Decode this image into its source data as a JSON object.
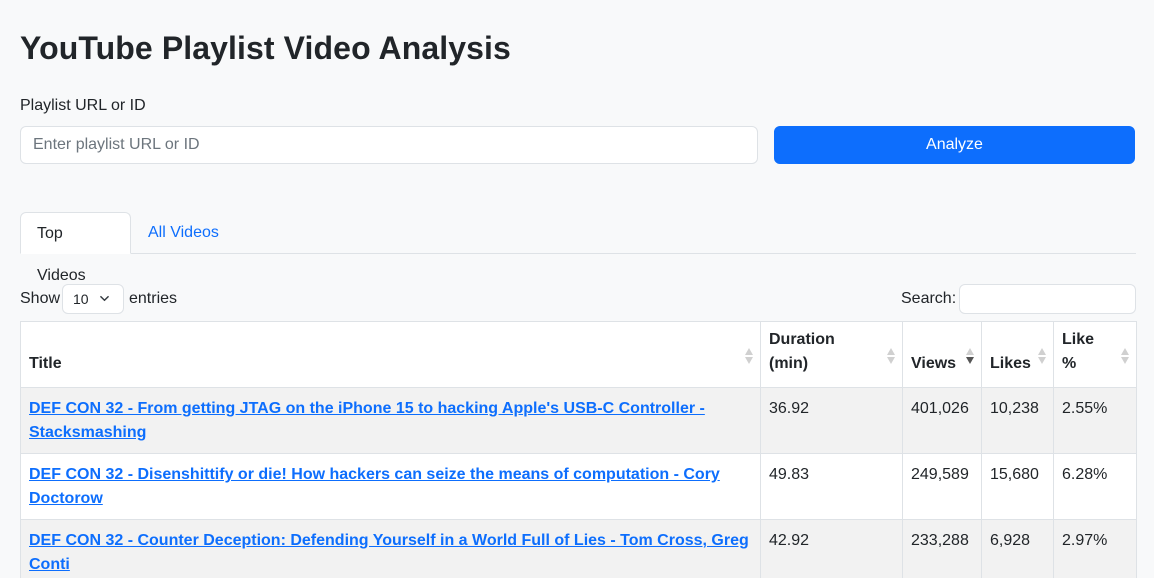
{
  "page": {
    "title": "YouTube Playlist Video Analysis"
  },
  "form": {
    "label": "Playlist URL or ID",
    "input_value": "",
    "placeholder": "Enter playlist URL or ID",
    "analyze_label": "Analyze"
  },
  "tabs": [
    {
      "label": "Top Videos",
      "active": true
    },
    {
      "label": "All Videos",
      "active": false
    }
  ],
  "table_controls": {
    "show_label": "Show",
    "entries_label": "entries",
    "page_length": "10",
    "search_label": "Search:",
    "search_value": ""
  },
  "table": {
    "columns": [
      {
        "label": "Title",
        "sort": "none"
      },
      {
        "label": "Duration (min)",
        "sort": "none"
      },
      {
        "label": "Views",
        "sort": "desc"
      },
      {
        "label": "Likes",
        "sort": "none"
      },
      {
        "label": "Like %",
        "sort": "none"
      }
    ],
    "rows": [
      {
        "title": "DEF CON 32 - From getting JTAG on the iPhone 15 to hacking Apple's USB-C Controller - Stacksmashing",
        "duration": "36.92",
        "views": "401,026",
        "likes": "10,238",
        "like_pct": "2.55%"
      },
      {
        "title": "DEF CON 32 - Disenshittify or die! How hackers can seize the means of computation - Cory Doctorow",
        "duration": "49.83",
        "views": "249,589",
        "likes": "15,680",
        "like_pct": "6.28%"
      },
      {
        "title": "DEF CON 32 - Counter Deception: Defending Yourself in a World Full of Lies - Tom Cross, Greg Conti",
        "duration": "42.92",
        "views": "233,288",
        "likes": "6,928",
        "like_pct": "2.97%"
      }
    ]
  },
  "colors": {
    "primary": "#0d6efd",
    "background": "#f8f9fa",
    "border": "#dee2e6",
    "stripe": "#f2f2f2"
  }
}
